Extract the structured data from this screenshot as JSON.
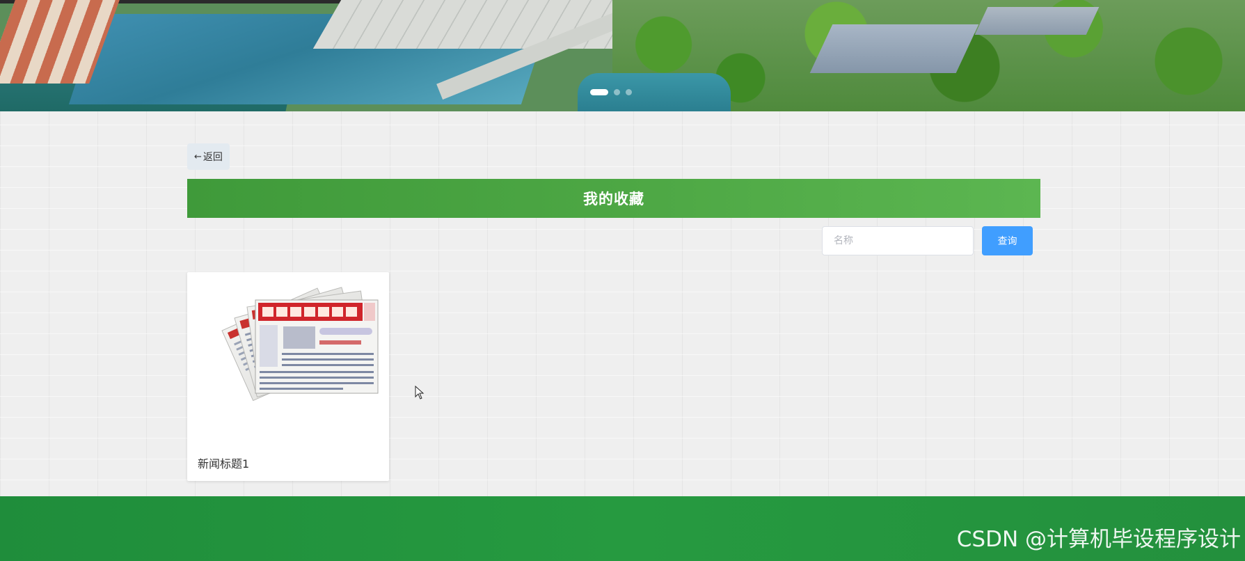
{
  "banner": {
    "slide_count": 3,
    "active_slide": 1
  },
  "nav": {
    "back_arrow": "←",
    "back_label": "返回"
  },
  "page": {
    "title": "我的收藏"
  },
  "search": {
    "placeholder": "名称",
    "value": "",
    "button_label": "查询"
  },
  "favorites": [
    {
      "title": "新闻标题1",
      "thumbnail": "newspaper-image"
    }
  ],
  "footer": {
    "watermark": "CSDN @计算机毕设程序设计"
  },
  "colors": {
    "title_bar": "#4ea845",
    "search_button": "#409eff",
    "footer": "#269a40"
  }
}
